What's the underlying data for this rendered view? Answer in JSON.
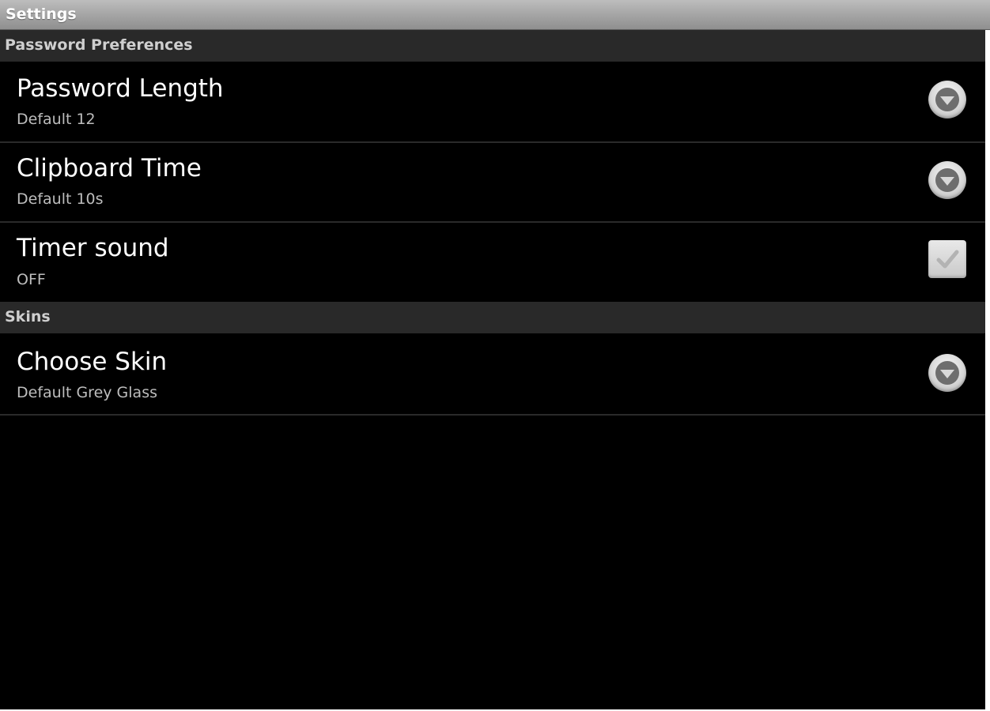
{
  "window": {
    "title": "Settings"
  },
  "categories": [
    {
      "label": "Password Preferences"
    },
    {
      "label": "Skins"
    }
  ],
  "preferences": [
    {
      "title": "Password Length",
      "summary": "Default 12",
      "control": "dropdown-icon"
    },
    {
      "title": "Clipboard Time",
      "summary": "Default 10s",
      "control": "dropdown-icon"
    },
    {
      "title": "Timer sound",
      "summary": "OFF",
      "control": "checkbox",
      "checked": false
    },
    {
      "title": "Choose Skin",
      "summary": "Default Grey Glass",
      "control": "dropdown-icon"
    }
  ],
  "colors": {
    "background": "#000000",
    "category_bg": "#292929",
    "title_text": "#ffffff",
    "summary_text": "#bdbdbd"
  }
}
